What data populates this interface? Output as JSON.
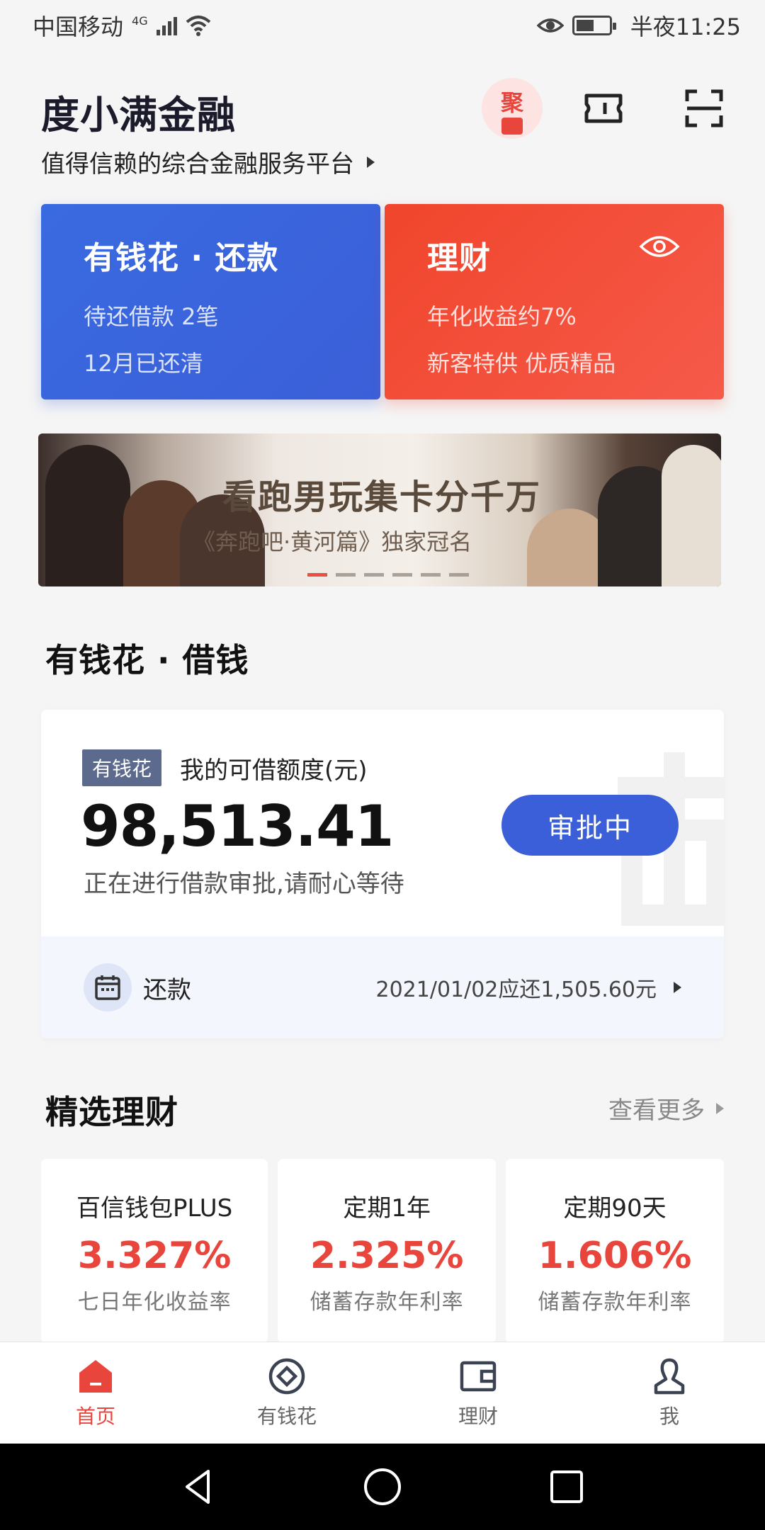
{
  "status_bar": {
    "carrier": "中国移动",
    "network": "4G",
    "time": "半夜11:25"
  },
  "header": {
    "app_title": "度小满金融",
    "subtitle": "值得信赖的综合金融服务平台",
    "ju_label": "聚"
  },
  "cards": [
    {
      "title": "有钱花 · 还款",
      "line1": "待还借款 2笔",
      "line2": "12月已还清",
      "color": "#3b5fd8"
    },
    {
      "title": "理财",
      "line1": "年化收益约7%",
      "line2": "新客特供 优质精品",
      "color": "#f0452c"
    }
  ],
  "banner": {
    "headline": "看跑男玩集卡分千万",
    "sub": "《奔跑吧·黄河篇》独家冠名",
    "slides": 6,
    "active_slide": 1
  },
  "loan_section": {
    "title": "有钱花 · 借钱",
    "tag": "有钱花",
    "limit_label": "我的可借额度(元)",
    "amount": "98,513.41",
    "button": "审批中",
    "note": "正在进行借款审批,请耐心等待",
    "repay_label": "还款",
    "repay_info": "2021/01/02应还1,505.60元"
  },
  "finance_section": {
    "title": "精选理财",
    "more": "查看更多",
    "products": [
      {
        "name": "百信钱包PLUS",
        "rate": "3.327%",
        "desc": "七日年化收益率"
      },
      {
        "name": "定期1年",
        "rate": "2.325%",
        "desc": "储蓄存款年利率"
      },
      {
        "name": "定期90天",
        "rate": "1.606%",
        "desc": "储蓄存款年利率"
      }
    ]
  },
  "tabbar": {
    "tabs": [
      {
        "label": "首页",
        "icon": "home-icon",
        "active": true
      },
      {
        "label": "有钱花",
        "icon": "coin-icon",
        "active": false
      },
      {
        "label": "理财",
        "icon": "wallet-icon",
        "active": false
      },
      {
        "label": "我",
        "icon": "person-icon",
        "active": false
      }
    ]
  },
  "colors": {
    "accent_red": "#e8453c",
    "accent_blue": "#3b5fd8"
  }
}
